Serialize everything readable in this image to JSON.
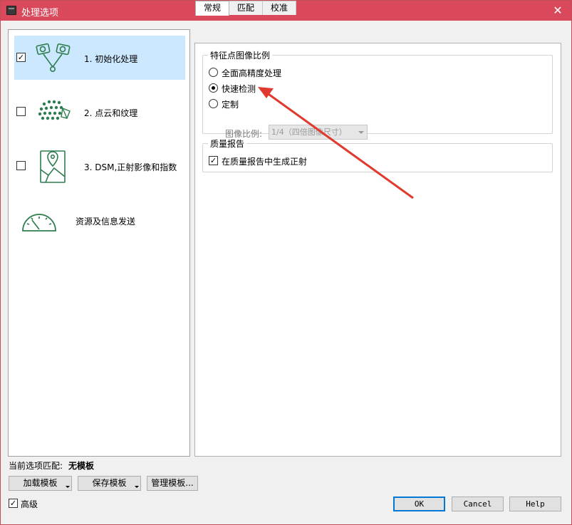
{
  "window": {
    "title": "处理选项",
    "close_glyph": "✕"
  },
  "nav": {
    "items": [
      {
        "label": "1. 初始化处理",
        "checked": true,
        "selected": true,
        "icon": "initial-processing-icon"
      },
      {
        "label": "2. 点云和纹理",
        "checked": false,
        "selected": false,
        "icon": "point-cloud-icon"
      },
      {
        "label": "3. DSM,正射影像和指数",
        "checked": false,
        "selected": false,
        "icon": "map-pin-icon"
      },
      {
        "label": "资源及信息发送",
        "checked": null,
        "selected": false,
        "icon": "gauge-icon"
      }
    ]
  },
  "tabs": {
    "items": [
      {
        "label": "常规",
        "active": true
      },
      {
        "label": "匹配",
        "active": false
      },
      {
        "label": "校准",
        "active": false
      }
    ]
  },
  "keypoint_scale": {
    "title": "特征点图像比例",
    "options": [
      {
        "label": "全面高精度处理",
        "selected": false
      },
      {
        "label": "快速检测",
        "selected": true
      },
      {
        "label": "定制",
        "selected": false
      }
    ],
    "image_scale_label": "图像比例:",
    "image_scale_value": "1/4（四倍图像尺寸）",
    "image_scale_enabled": false
  },
  "quality_report": {
    "title": "质量报告",
    "generate_label": "在质量报告中生成正射",
    "generate_checked": true
  },
  "footer": {
    "current_match_label": "当前选项匹配:",
    "current_match_value": "无模板",
    "load_template": "加载模板",
    "save_template": "保存模板",
    "manage_template": "管理模板...",
    "advanced_label": "高级",
    "advanced_checked": true,
    "ok": "OK",
    "cancel": "Cancel",
    "help": "Help"
  },
  "colors": {
    "titlebar": "#d9495b",
    "selection": "#cce8ff",
    "icon_green": "#2e7d4f",
    "annotation_arrow": "#e03a2f"
  }
}
